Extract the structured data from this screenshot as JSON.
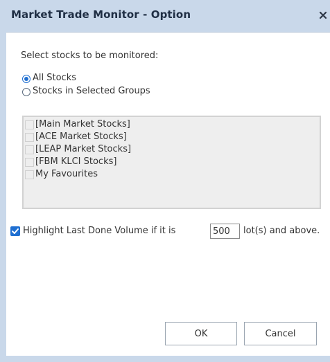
{
  "window": {
    "title": "Market Trade Monitor - Option",
    "close_icon": "close-icon"
  },
  "select_prompt": "Select stocks to be monitored:",
  "options": {
    "all_stocks": {
      "label": "All Stocks",
      "selected": true
    },
    "selected_groups": {
      "label": "Stocks in Selected Groups",
      "selected": false
    }
  },
  "groups": [
    {
      "label": "[Main Market Stocks]",
      "checked": false
    },
    {
      "label": "[ACE Market Stocks]",
      "checked": false
    },
    {
      "label": "[LEAP Market Stocks]",
      "checked": false
    },
    {
      "label": "[FBM KLCI Stocks]",
      "checked": false
    },
    {
      "label": "My Favourites",
      "checked": false
    }
  ],
  "highlight": {
    "checked": true,
    "label_before": "Highlight Last Done Volume if it is",
    "value": "500",
    "label_after": "lot(s) and above."
  },
  "buttons": {
    "ok": "OK",
    "cancel": "Cancel"
  },
  "colors": {
    "frame": "#c9d8ea",
    "accent": "#1f6fd1",
    "title_text": "#1f2e44"
  }
}
